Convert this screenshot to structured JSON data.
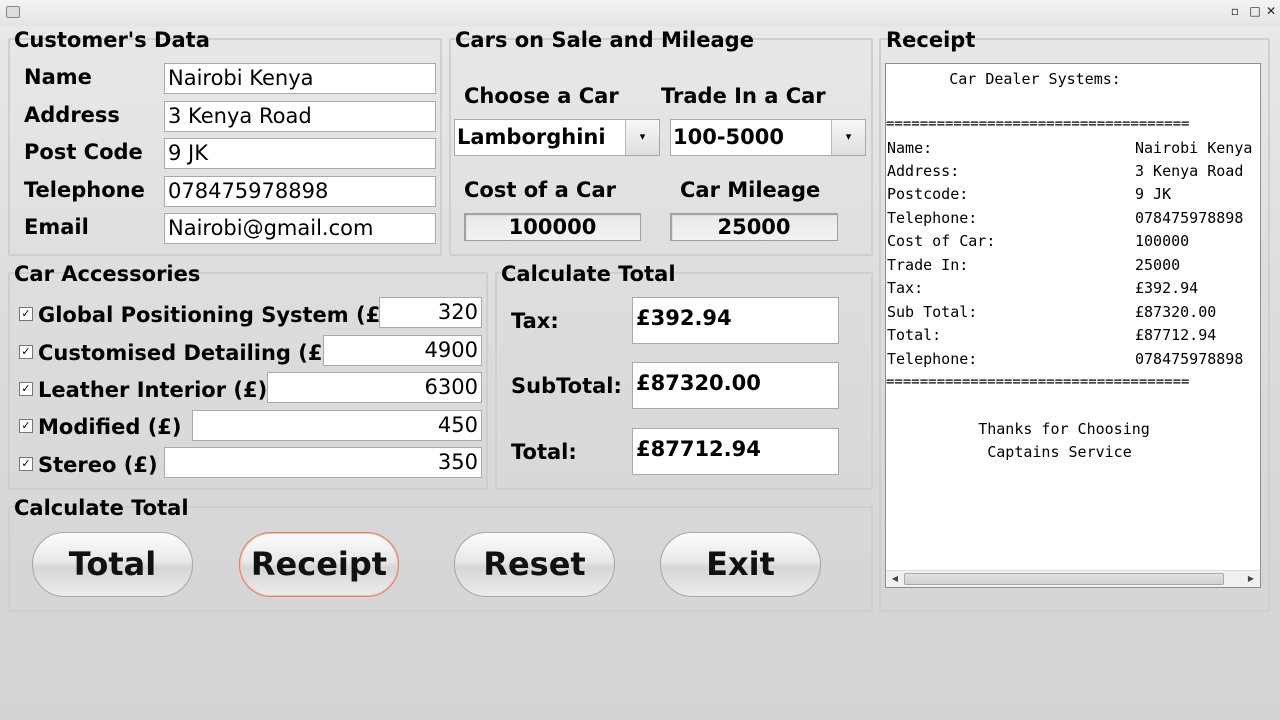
{
  "window": {
    "icon": "app-icon",
    "minimize": "▫",
    "maximize": "□",
    "close": "✕"
  },
  "customer": {
    "caption": "Customer's Data",
    "name_label": "Name",
    "name_value": "Nairobi Kenya",
    "address_label": "Address",
    "address_value": "3 Kenya Road",
    "postcode_label": "Post Code",
    "postcode_value": "9 JK",
    "telephone_label": "Telephone",
    "telephone_value": "078475978898",
    "email_label": "Email",
    "email_value": "Nairobi@gmail.com"
  },
  "cars": {
    "caption": "Cars on Sale and Mileage",
    "choose_label": "Choose a Car",
    "choose_value": "Lamborghini",
    "trade_label": "Trade In a Car",
    "trade_value": "100-5000",
    "cost_label": "Cost of a Car",
    "cost_value": "100000",
    "mileage_label": "Car Mileage",
    "mileage_value": "25000"
  },
  "accessories": {
    "caption": "Car Accessories",
    "items": [
      {
        "label": "Global Positioning System (£)",
        "value": "320",
        "checked": true
      },
      {
        "label": "Customised Detailing (£)",
        "value": "4900",
        "checked": true
      },
      {
        "label": "Leather Interior (£)",
        "value": "6300",
        "checked": true
      },
      {
        "label": "Modified (£)",
        "value": "450",
        "checked": true
      },
      {
        "label": "Stereo  (£)",
        "value": "350",
        "checked": true
      }
    ],
    "check_mark": "✓"
  },
  "totals": {
    "caption": "Calculate Total",
    "tax_label": "Tax:",
    "tax_value": "£392.94",
    "subtotal_label": "SubTotal:",
    "subtotal_value": "£87320.00",
    "total_label": "Total:",
    "total_value": "£87712.94"
  },
  "actions": {
    "caption": "Calculate Total",
    "total_button": "Total",
    "receipt_button": "Receipt",
    "reset_button": "Reset",
    "exit_button": "Exit"
  },
  "receipt": {
    "caption": "Receipt",
    "header": "       Car Dealer Systems:",
    "separator": "====================================",
    "lines": [
      {
        "label": "Name:",
        "value": "Nairobi Kenya"
      },
      {
        "label": "Address:",
        "value": "3 Kenya Road"
      },
      {
        "label": "Postcode:",
        "value": "9 JK"
      },
      {
        "label": "Telephone:",
        "value": "078475978898"
      },
      {
        "label": "Cost of Car:",
        "value": "100000"
      },
      {
        "label": "Trade In:",
        "value": "25000"
      },
      {
        "label": "Tax:",
        "value": "£392.94"
      },
      {
        "label": "Sub Total:",
        "value": "£87320.00"
      },
      {
        "label": "Total:",
        "value": "£87712.94"
      },
      {
        "label": "Telephone:",
        "value": "078475978898"
      }
    ],
    "footer_1": "       Thanks for Choosing",
    "footer_2": "        Captains Service",
    "scroll_left": "◀",
    "scroll_right": "▶"
  }
}
